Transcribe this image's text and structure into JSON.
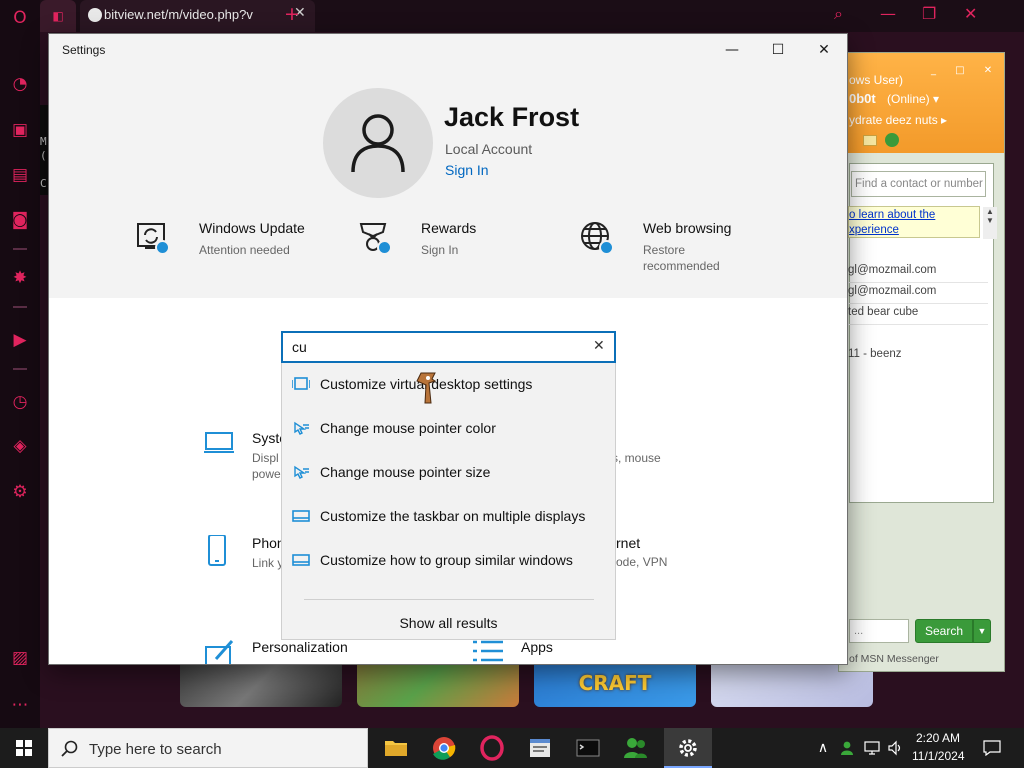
{
  "browser": {
    "tab_title": "bitview.net/m/video.php?v",
    "tab_close": "✕",
    "new_tab": "+",
    "accent": "#e0245e",
    "sidebar_icons": [
      "opera-icon",
      "speed-dial-icon",
      "shopping-bag-icon",
      "twitch-icon",
      "instagram-icon",
      "aria-icon",
      "player-icon",
      "history-icon",
      "cube-icon",
      "settings-icon",
      "gallery-icon"
    ],
    "thumb_text": "CRAFT",
    "terminal_lines": [
      "M",
      "(",
      "C"
    ]
  },
  "settings": {
    "window_title": "Settings",
    "window_buttons": {
      "minimize": "—",
      "maximize": "☐",
      "close": "✕"
    },
    "user": {
      "name": "Jack Frost",
      "account_type": "Local Account",
      "sign_in": "Sign In"
    },
    "tiles": [
      {
        "title": "Windows Update",
        "subtitle": "Attention needed",
        "icon": "windows-update-icon"
      },
      {
        "title": "Rewards",
        "subtitle": "Sign In",
        "icon": "rewards-icon"
      },
      {
        "title": "Web browsing",
        "subtitle": "Restore recommended",
        "subtitle_line1": "Restore",
        "subtitle_line2": "recommended",
        "icon": "web-browsing-icon"
      }
    ],
    "search": {
      "value": "cu",
      "clear": "✕"
    },
    "results": [
      {
        "label": "Customize virtual desktop settings",
        "icon": "virtual-desktop-icon"
      },
      {
        "label": "Change mouse pointer color",
        "icon": "mouse-pointer-icon"
      },
      {
        "label": "Change mouse pointer size",
        "icon": "mouse-pointer-icon"
      },
      {
        "label": "Customize the taskbar on multiple displays",
        "icon": "taskbar-icon"
      },
      {
        "label": "Customize how to group similar windows",
        "icon": "taskbar-icon"
      }
    ],
    "show_all": "Show all results",
    "categories": {
      "system": {
        "title": "Syste",
        "desc1": "Displ",
        "desc2": "powe",
        "desc_right": "s, mouse"
      },
      "phone": {
        "title": "Phon",
        "desc1": "Link y"
      },
      "network": {
        "title": "rnet",
        "desc1": "ode, VPN"
      },
      "personalization": {
        "title": "Personalization"
      },
      "apps": {
        "title": "Apps"
      }
    }
  },
  "msn": {
    "header_line1": "ows User)",
    "header_user": "0b0t",
    "header_status": "(Online) ▾",
    "header_message": "ydrate deez nuts ▸",
    "window_buttons": "_ □ ✕",
    "find_placeholder": "Find a contact or number",
    "link_line1": "o learn about the",
    "link_line2": "xperience",
    "contacts": [
      "gl@mozmail.com",
      "gl@mozmail.com",
      "ted bear cube",
      "11 - beenz"
    ],
    "search_placeholder": "...",
    "search_button": "Search",
    "footer": "of MSN Messenger"
  },
  "taskbar": {
    "search_placeholder": "Type here to search",
    "time": "2:20 AM",
    "date": "11/1/2024",
    "apps": [
      "file-explorer-icon",
      "chrome-icon",
      "opera-icon",
      "notepad-icon",
      "terminal-icon",
      "msn-messenger-icon",
      "settings-icon"
    ],
    "tray_icons": [
      "chevron-up-icon",
      "msn-tray-icon",
      "network-icon",
      "volume-icon",
      "notification-icon"
    ]
  }
}
